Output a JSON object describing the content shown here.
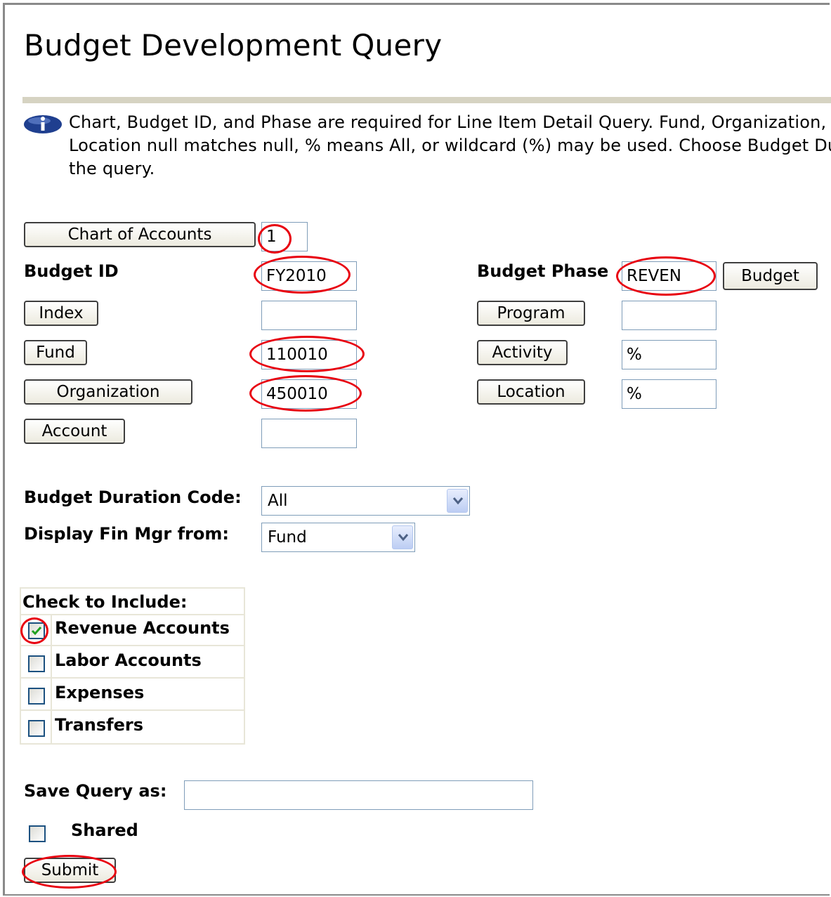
{
  "page": {
    "title": "Budget Development Query",
    "info_text": "Chart, Budget ID, and Phase are required for Line Item Detail Query. Fund, Organization, Account, Program, Activity, and\nLocation null matches null, % means All, or wildcard (%) may be used. Choose Budget Duration Code and Financial Manager for\nthe query."
  },
  "form": {
    "chart_button": "Chart of Accounts",
    "chart_value": "1",
    "budget_id_label": "Budget ID",
    "budget_id_value": "FY2010",
    "budget_phase_label": "Budget Phase",
    "budget_phase_value": "REVEN",
    "budget_button": "Budget",
    "index_button": "Index",
    "index_value": "",
    "program_button": "Program",
    "program_value": "",
    "fund_button": "Fund",
    "fund_value": "110010",
    "activity_button": "Activity",
    "activity_value": "%",
    "organization_button": "Organization",
    "organization_value": "450010",
    "location_button": "Location",
    "location_value": "%",
    "account_button": "Account",
    "account_value": "",
    "duration_label": "Budget Duration Code:",
    "duration_value": "All",
    "finmgr_label": "Display Fin Mgr from:",
    "finmgr_value": "Fund"
  },
  "include": {
    "header": "Check to Include:",
    "items": [
      {
        "label": "Revenue Accounts",
        "checked": true
      },
      {
        "label": "Labor Accounts",
        "checked": false
      },
      {
        "label": "Expenses",
        "checked": false
      },
      {
        "label": "Transfers",
        "checked": false
      }
    ]
  },
  "save": {
    "label": "Save Query as:",
    "value": "",
    "shared_label": "Shared",
    "shared_checked": false,
    "submit_label": "Submit"
  },
  "colors": {
    "highlight_ring": "#e8000f",
    "checkmark": "#21a121",
    "rule": "#d6d3c2"
  }
}
